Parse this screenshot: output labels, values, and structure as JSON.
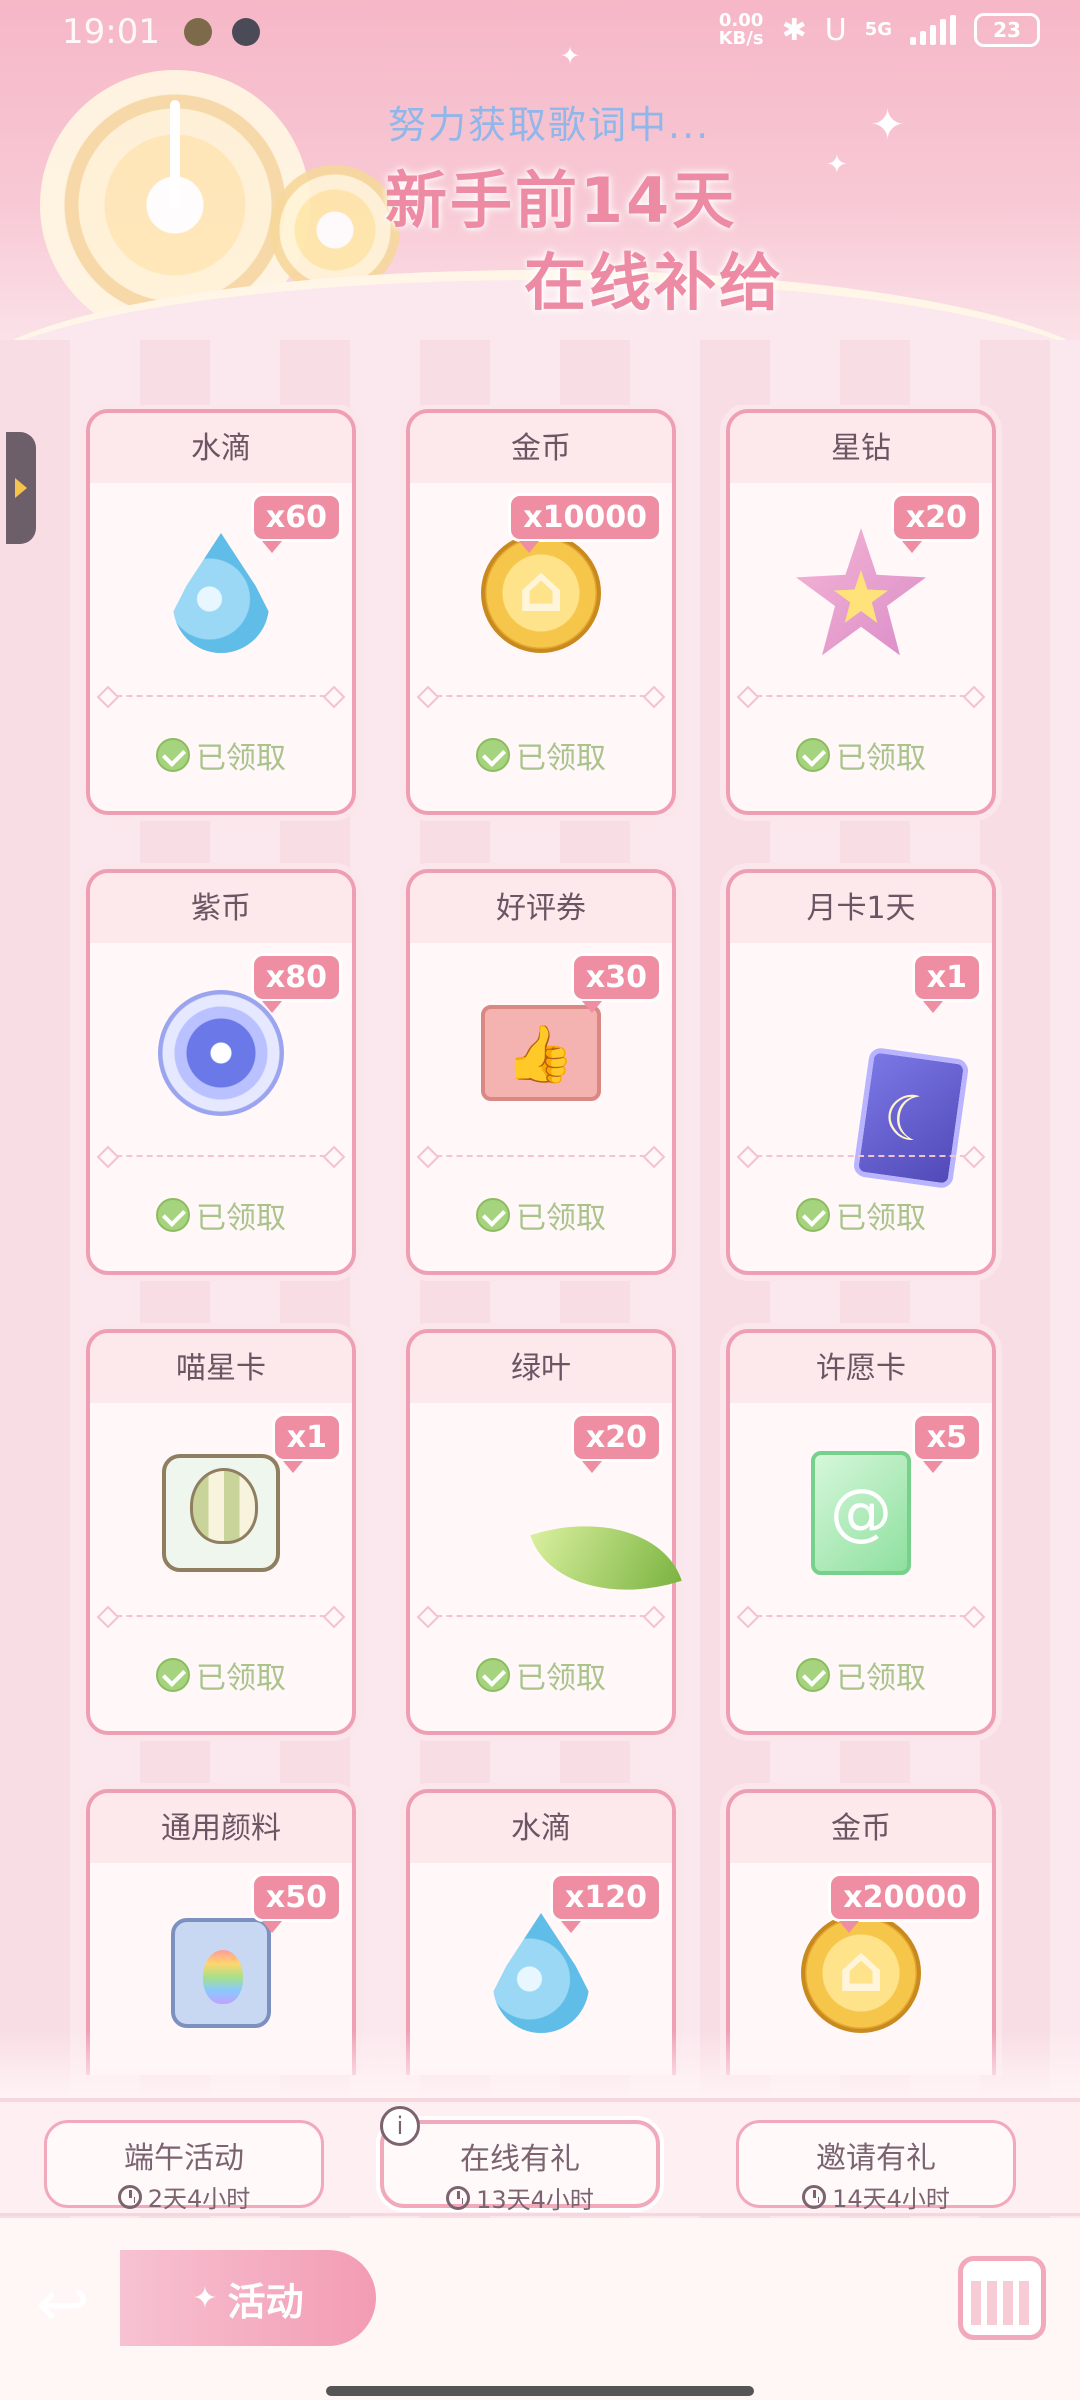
{
  "status_bar": {
    "time": "19:01",
    "net_speed": "0.00\nKB/s",
    "signal": "5G",
    "battery": "23"
  },
  "header": {
    "subtitle": "努力获取歌词中...",
    "title_line1": "新手前14天",
    "title_line2": "在线补给"
  },
  "rewards": [
    {
      "name": "水滴",
      "qty": "x60",
      "icon": "water-drop-icon",
      "status": "已领取"
    },
    {
      "name": "金币",
      "qty": "x10000",
      "icon": "gold-coin-icon",
      "status": "已领取"
    },
    {
      "name": "星钻",
      "qty": "x20",
      "icon": "star-diamond-icon",
      "status": "已领取"
    },
    {
      "name": "紫币",
      "qty": "x80",
      "icon": "purple-coin-icon",
      "status": "已领取"
    },
    {
      "name": "好评券",
      "qty": "x30",
      "icon": "thumbs-up-voucher-icon",
      "status": "已领取"
    },
    {
      "name": "月卡1天",
      "qty": "x1",
      "icon": "moon-card-icon",
      "status": "已领取"
    },
    {
      "name": "喵星卡",
      "qty": "x1",
      "icon": "hot-air-balloon-card-icon",
      "status": "已领取"
    },
    {
      "name": "绿叶",
      "qty": "x20",
      "icon": "green-leaf-icon",
      "status": "已领取"
    },
    {
      "name": "许愿卡",
      "qty": "x5",
      "icon": "wish-card-icon",
      "status": "已领取"
    },
    {
      "name": "通用颜料",
      "qty": "x50",
      "icon": "paint-bucket-icon",
      "status": ""
    },
    {
      "name": "水滴",
      "qty": "x120",
      "icon": "water-drop-icon",
      "status": ""
    },
    {
      "name": "金币",
      "qty": "x20000",
      "icon": "gold-coin-icon",
      "status": ""
    }
  ],
  "tabs": [
    {
      "label": "端午活动",
      "time": "2天4小时"
    },
    {
      "label": "在线有礼",
      "time": "13天4小时",
      "active": true
    },
    {
      "label": "邀请有礼",
      "time": "14天4小时"
    }
  ],
  "bottom": {
    "activity_label": "活动",
    "back_icon": "back-arrow-icon",
    "calendar_icon": "calendar-icon"
  },
  "colors": {
    "accent": "#ef8ea3",
    "claimed": "#a9c38a",
    "background": "#f9e4ea"
  }
}
